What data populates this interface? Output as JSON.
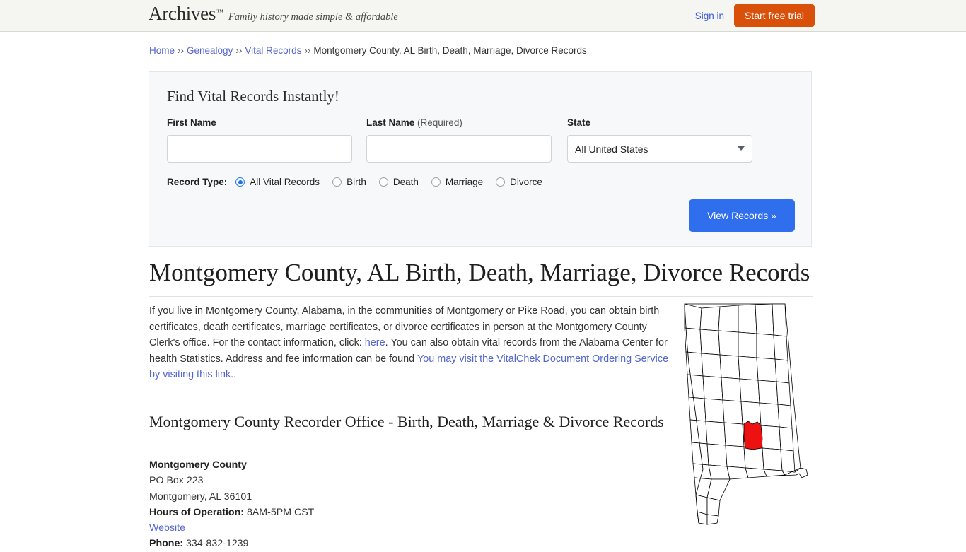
{
  "header": {
    "logo_text": "Archives",
    "logo_tm": "™",
    "tagline": "Family history made simple & affordable",
    "signin_label": "Sign in",
    "trial_label": "Start free trial",
    "bg_color": "#f5f5f1",
    "trial_color": "#d9500b",
    "link_color": "#3b5bdb"
  },
  "breadcrumb": {
    "separator": "››",
    "items": [
      {
        "label": "Home",
        "link": true
      },
      {
        "label": "Genealogy",
        "link": true
      },
      {
        "label": "Vital Records",
        "link": true
      },
      {
        "label": "Montgomery County, AL Birth, Death, Marriage, Divorce Records",
        "link": false
      }
    ]
  },
  "search_panel": {
    "title": "Find Vital Records Instantly!",
    "first_name": {
      "label": "First Name",
      "value": "",
      "placeholder": ""
    },
    "last_name": {
      "label": "Last Name",
      "required_note": "(Required)",
      "value": "",
      "placeholder": ""
    },
    "state": {
      "label": "State",
      "selected": "All United States",
      "caret_icon": "chevron-down-icon"
    },
    "record_type": {
      "label": "Record Type:",
      "options": [
        {
          "label": "All Vital Records",
          "checked": true
        },
        {
          "label": "Birth",
          "checked": false
        },
        {
          "label": "Death",
          "checked": false
        },
        {
          "label": "Marriage",
          "checked": false
        },
        {
          "label": "Divorce",
          "checked": false
        }
      ]
    },
    "submit_label": "View Records »",
    "submit_color": "#2f6fed",
    "panel_bg": "#f6f8fa"
  },
  "main": {
    "title": "Montgomery County, AL Birth, Death, Marriage, Divorce Records",
    "intro": {
      "part1": "If you live in Montgomery County, Alabama, in the communities of Montgomery or Pike Road, you can obtain birth certificates, death certificates, marriage certificates, or divorce certificates in person at the Montgomery County Clerk's office. For the contact information, click: ",
      "link1": "here",
      "part2": ". You can also obtain vital records from the Alabama Center for health Statistics. Address and fee information can be found ",
      "link2": "You may visit the VitalChek Document Ordering Service by visiting this link..",
      "part3": ""
    },
    "sub_heading": "Montgomery County Recorder Office - Birth, Death, Marriage & Divorce Records",
    "office": {
      "name": "Montgomery County",
      "address_line1": "PO Box 223",
      "address_line2": "Montgomery, AL 36101",
      "hours_label": "Hours of Operation:",
      "hours_value": "8AM-5PM CST",
      "website_label": "Website",
      "phone_label": "Phone:",
      "phone_value": "334-832-1239"
    },
    "map": {
      "name": "alabama-county-map",
      "highlighted_county": "Montgomery",
      "highlight_color": "#ee1111",
      "outline_color": "#000000"
    }
  }
}
